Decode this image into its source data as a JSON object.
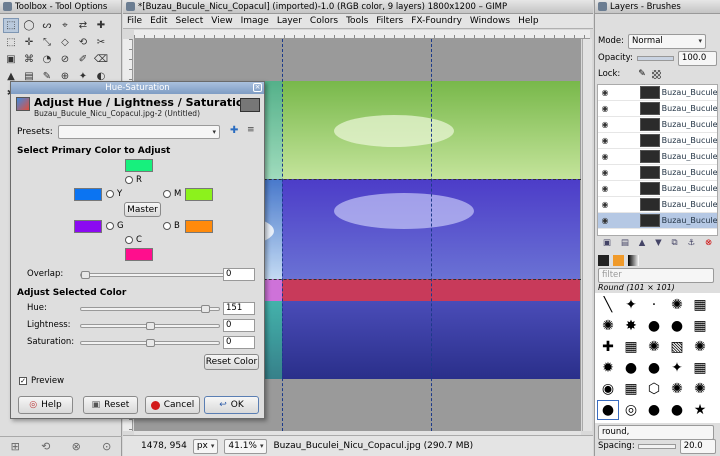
{
  "toolbox": {
    "title": "Toolbox - Tool Options",
    "tools": [
      "⬚",
      "◯",
      "ᔕ",
      "⌖",
      "⇄",
      "✚",
      "⬚",
      "✛",
      "⤡",
      "◇",
      "⟲",
      "✂",
      "▣",
      "⌘",
      "◔",
      "⊘",
      "✐",
      "⌫",
      "▲",
      "▤",
      "✎",
      "⊕",
      "✦",
      "◐",
      "✱",
      "A",
      "⊙",
      "⊹",
      "◑",
      "✧"
    ],
    "bottom_icons": [
      "⊞",
      "⟲",
      "⊗",
      "⊙"
    ]
  },
  "imagewin": {
    "title": "*[Buzau_Bucule_Nicu_Copacul] (imported)-1.0 (RGB color, 9 layers) 1800x1200 – GIMP",
    "menu": [
      "File",
      "Edit",
      "Select",
      "View",
      "Image",
      "Layer",
      "Colors",
      "Tools",
      "Filters",
      "FX-Foundry",
      "Windows",
      "Help"
    ],
    "status": {
      "coords": "1478, 954",
      "unit": "px",
      "zoom": "41.1%",
      "info": "Buzau_Buculei_Nicu_Copacul.jpg (290.7 MB)"
    }
  },
  "dock": {
    "title": "Layers - Brushes",
    "mode_label": "Mode:",
    "mode_value": "Normal",
    "opacity_label": "Opacity:",
    "opacity_value": "100.0",
    "lock_label": "Lock:",
    "layers": [
      {
        "name": "Buzau_Bucule"
      },
      {
        "name": "Buzau_Bucule"
      },
      {
        "name": "Buzau_Bucule"
      },
      {
        "name": "Buzau_Bucule"
      },
      {
        "name": "Buzau_Bucule"
      },
      {
        "name": "Buzau_Bucule"
      },
      {
        "name": "Buzau_Bucule"
      },
      {
        "name": "Buzau_Bucule"
      },
      {
        "name": "Buzau_Bucule"
      }
    ],
    "filter_placeholder": "filter",
    "brush_name": "Round (101 × 101)",
    "brush_tag": "round,",
    "spacing_label": "Spacing:",
    "spacing_value": "20.0",
    "brushes": [
      "╲",
      "✦",
      "·",
      "✺",
      "▦",
      "✺",
      "✸",
      "●",
      "●",
      "▦",
      "✚",
      "▦",
      "✺",
      "▧",
      "✺",
      "✹",
      "●",
      "●",
      "✦",
      "▦",
      "◉",
      "▦",
      "⬡",
      "✺",
      "✺",
      "●",
      "◎",
      "●",
      "●",
      "★"
    ]
  },
  "dialog": {
    "title": "Hue-Saturation",
    "heading": "Adjust Hue / Lightness / Saturation",
    "subtitle": "Buzau_Bucule_Nicu_Copacul.jpg-2 (Untitled)",
    "presets_label": "Presets:",
    "primary_heading": "Select Primary Color to Adjust",
    "radios": {
      "r": "R",
      "y": "Y",
      "m": "M",
      "g": "G",
      "b": "B",
      "c": "C"
    },
    "colors": {
      "r": "#17f07d",
      "y": "#0b74f2",
      "m": "#8cf21c",
      "g": "#8b0af2",
      "b": "#ff8a0b",
      "c": "#ff0e8d"
    },
    "master_label": "Master",
    "overlap_label": "Overlap:",
    "overlap_value": "0",
    "adjust_heading": "Adjust Selected Color",
    "hue_label": "Hue:",
    "hue_value": "151",
    "lightness_label": "Lightness:",
    "lightness_value": "0",
    "saturation_label": "Saturation:",
    "saturation_value": "0",
    "reset_color_label": "Reset Color",
    "preview_label": "Preview",
    "help_label": "Help",
    "reset_label": "Reset",
    "cancel_label": "Cancel",
    "ok_label": "OK"
  }
}
